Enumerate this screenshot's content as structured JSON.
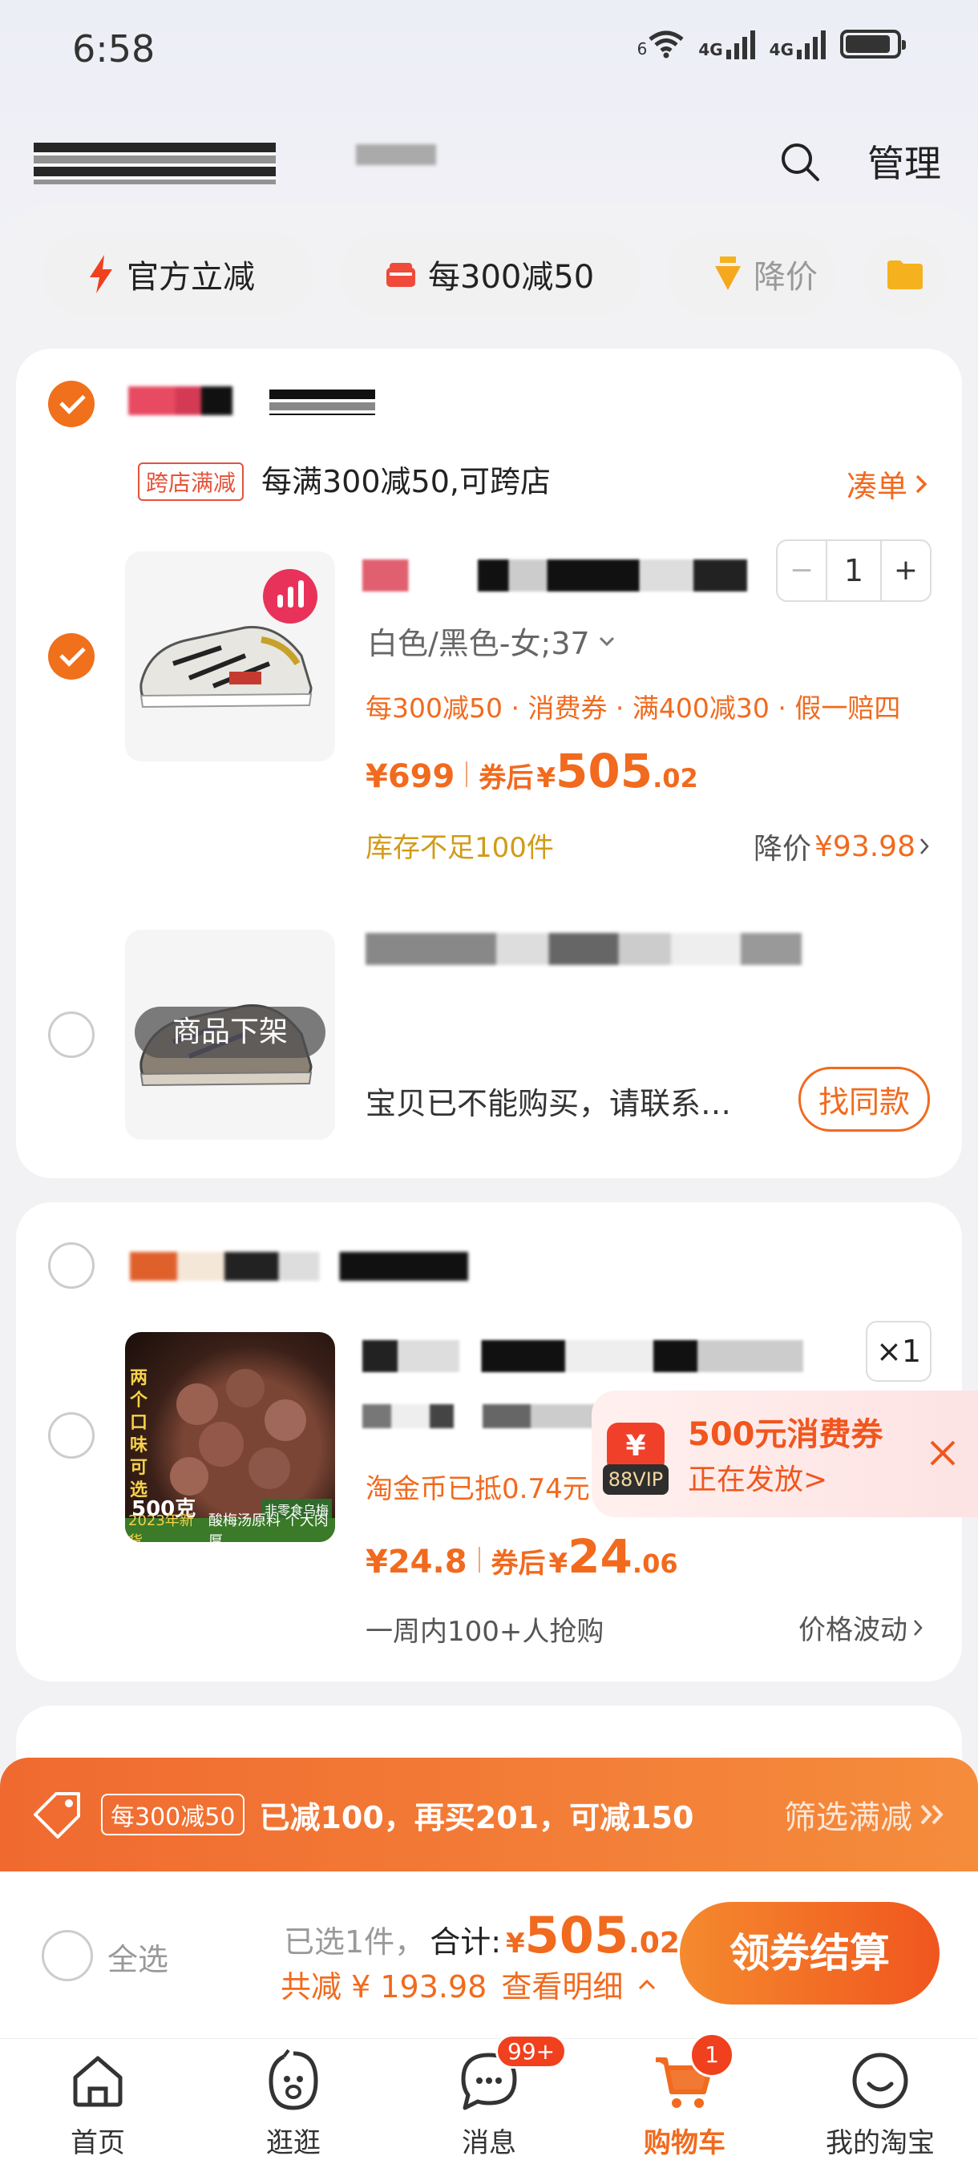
{
  "status": {
    "time": "6:58",
    "net1": "6",
    "net2": "4G",
    "net3": "4G"
  },
  "header": {
    "manage": "管理"
  },
  "chips": [
    {
      "label": "官方立减"
    },
    {
      "label": "每300减50"
    },
    {
      "label": "降价"
    }
  ],
  "store1": {
    "promo_tag": "跨店满减",
    "promo_text": "每满300减50,可跨店",
    "combine": "凑单",
    "item1": {
      "spec": "白色/黑色-女;37",
      "promos": "每300减50 · 消费券 · 满400减30 · 假一赔四",
      "price": "¥699",
      "after_label": "券后",
      "after_symbol": "¥",
      "after_int": "505",
      "after_dec": ".02",
      "stock": "库存不足100件",
      "drop_label": "降价",
      "drop_amount": "¥93.98",
      "qty": "1",
      "minus": "−",
      "plus": "+"
    },
    "item2": {
      "overlay": "商品下架",
      "notice": "宝贝已不能购买，请联系…",
      "find_similar": "找同款"
    }
  },
  "store2": {
    "item": {
      "qty_badge": "×1",
      "coin": "淘金币已抵0.74元",
      "price": "¥24.8",
      "after_label": "券后",
      "after_symbol": "¥",
      "after_int": "24",
      "after_dec": ".06",
      "hot": "一周内100+人抢购",
      "trend": "价格波动",
      "thumb_side": "两个口味可选",
      "thumb_weight": "500克",
      "thumb_year": "2023年新货",
      "thumb_desc": "酸梅汤原料 个大肉厚",
      "thumb_brand": "非零食乌梅"
    }
  },
  "coupon": {
    "title": "500元消费券",
    "sub": "正在发放>",
    "vip": "88VIP"
  },
  "promo_bar": {
    "tag": "每300减50",
    "text": "已减100，再买201，可减150",
    "filter": "筛选满减"
  },
  "checkout": {
    "select_all": "全选",
    "selected": "已选1件，",
    "total_label": "合计:",
    "total_symbol": "¥",
    "total_int": "505",
    "total_dec": ".02",
    "saved": "共减 ¥ 193.98",
    "detail": "查看明细",
    "pay": "领券结算"
  },
  "tabs": [
    {
      "label": "首页"
    },
    {
      "label": "逛逛"
    },
    {
      "label": "消息",
      "badge": "99+"
    },
    {
      "label": "购物车",
      "badge": "1"
    },
    {
      "label": "我的淘宝"
    }
  ],
  "colors": {
    "accent": "#f16a1e",
    "gold": "#d19a17",
    "badge": "#f0401e"
  }
}
